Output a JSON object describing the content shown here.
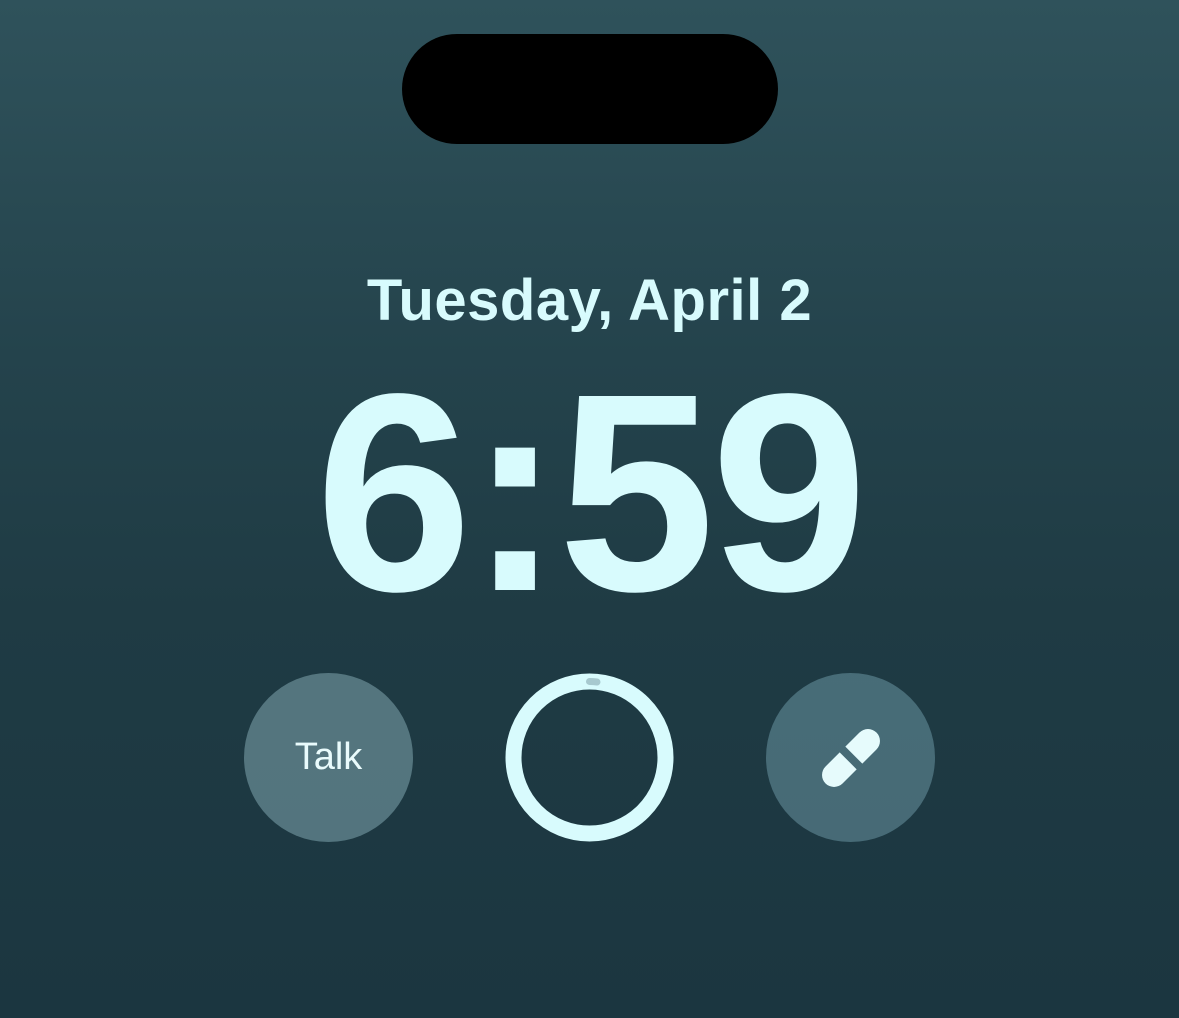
{
  "lock_screen": {
    "date": "Tuesday, April 2",
    "time": "6:59"
  },
  "widgets": {
    "talk": {
      "label": "Talk"
    },
    "ring": {
      "icon": "activity-ring-icon",
      "progress": 0.01
    },
    "medication": {
      "icon": "pill-icon"
    }
  },
  "colors": {
    "text": "#d8fbfd",
    "background_top": "#2f525b",
    "background_bottom": "#1b3640"
  }
}
